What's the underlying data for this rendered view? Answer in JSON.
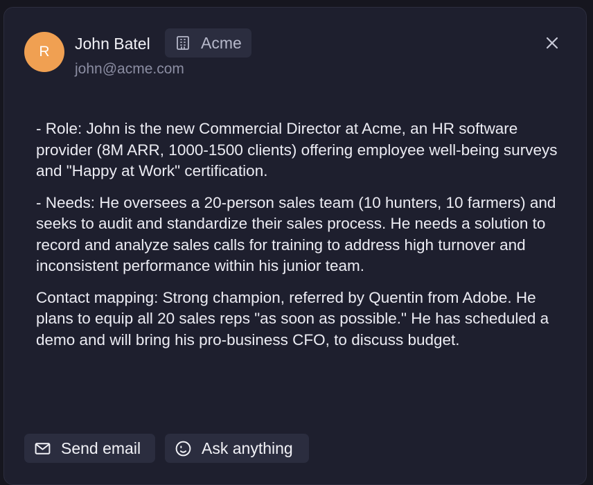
{
  "contact": {
    "avatar_initial": "R",
    "name": "John Batel",
    "company": "Acme",
    "email": "john@acme.com"
  },
  "icons": {
    "company": "building-icon",
    "close": "close-icon",
    "send_email": "mail-icon",
    "ask_anything": "smile-icon"
  },
  "notes": [
    "- Role: John is the new Commercial Director at Acme, an HR software provider (8M ARR, 1000-1500 clients) offering employee well-being surveys and \"Happy at Work\" certification.",
    "- Needs: He oversees a 20-person sales team (10 hunters, 10 farmers) and seeks to audit and standardize their sales process. He needs a solution to record and analyze sales calls for training to address high turnover and inconsistent performance within his junior team.",
    "Contact mapping: Strong champion, referred by Quentin from Adobe. He plans to equip all 20 sales reps \"as soon as possible.\" He has scheduled a demo and will bring his pro-business CFO, to discuss budget."
  ],
  "actions": {
    "send_email": "Send email",
    "ask_anything": "Ask anything"
  },
  "colors": {
    "background": "#1e1f2e",
    "avatar": "#f0a052",
    "chip": "#2b2d3f",
    "text": "#ececf3",
    "muted": "#8b8da2"
  }
}
